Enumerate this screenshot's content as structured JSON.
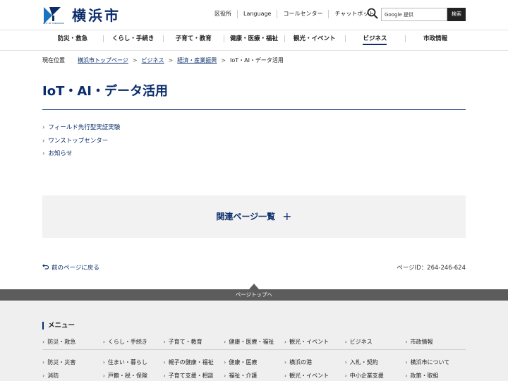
{
  "header": {
    "logo_small": "CITY OF YOKOHAMA",
    "logo_text": "横浜市",
    "util_links": [
      "区役所",
      "Language",
      "コールセンター",
      "チャットボット"
    ],
    "search_placeholder": "Google 提供",
    "search_button": "検索"
  },
  "gnav": {
    "items": [
      "防災・救急",
      "くらし・手続き",
      "子育て・教育",
      "健康・医療・福祉",
      "観光・イベント",
      "ビジネス",
      "市政情報"
    ],
    "active": "ビジネス"
  },
  "breadcrumb": {
    "current_label": "現在位置",
    "items": [
      "横浜市トップページ",
      "ビジネス",
      "経済・産業振興"
    ],
    "current": "IoT・AI・データ活用"
  },
  "main": {
    "title": "IoT・AI・データ活用",
    "links": [
      "フィールド先行型実証実験",
      "ワンストップセンター",
      "お知らせ"
    ],
    "related": "関連ページ一覧",
    "related_plus": "+",
    "back": "前のページに戻る",
    "page_id": "ページID：264-246-624"
  },
  "pagetop": {
    "label": "ページトップへ"
  },
  "footer": {
    "menu_title": "メニュー",
    "categories": [
      "防災・救急",
      "くらし・手続き",
      "子育て・教育",
      "健康・医療・福祉",
      "観光・イベント",
      "ビジネス",
      "市政情報"
    ],
    "columns": [
      [
        "防災・災害",
        "消防"
      ],
      [
        "住まい・暮らし",
        "戸籍・税・保険"
      ],
      [
        "親子の健康・福祉",
        "子育て支援・相談"
      ],
      [
        "健康・医療",
        "福祉・介護"
      ],
      [
        "横浜の港",
        "観光・イベント"
      ],
      [
        "入札・契約",
        "中小企業支援"
      ],
      [
        "横浜市について",
        "政策・取組"
      ]
    ]
  },
  "colors": {
    "brand": "#0b2d6b",
    "accent": "#1a74c0"
  }
}
